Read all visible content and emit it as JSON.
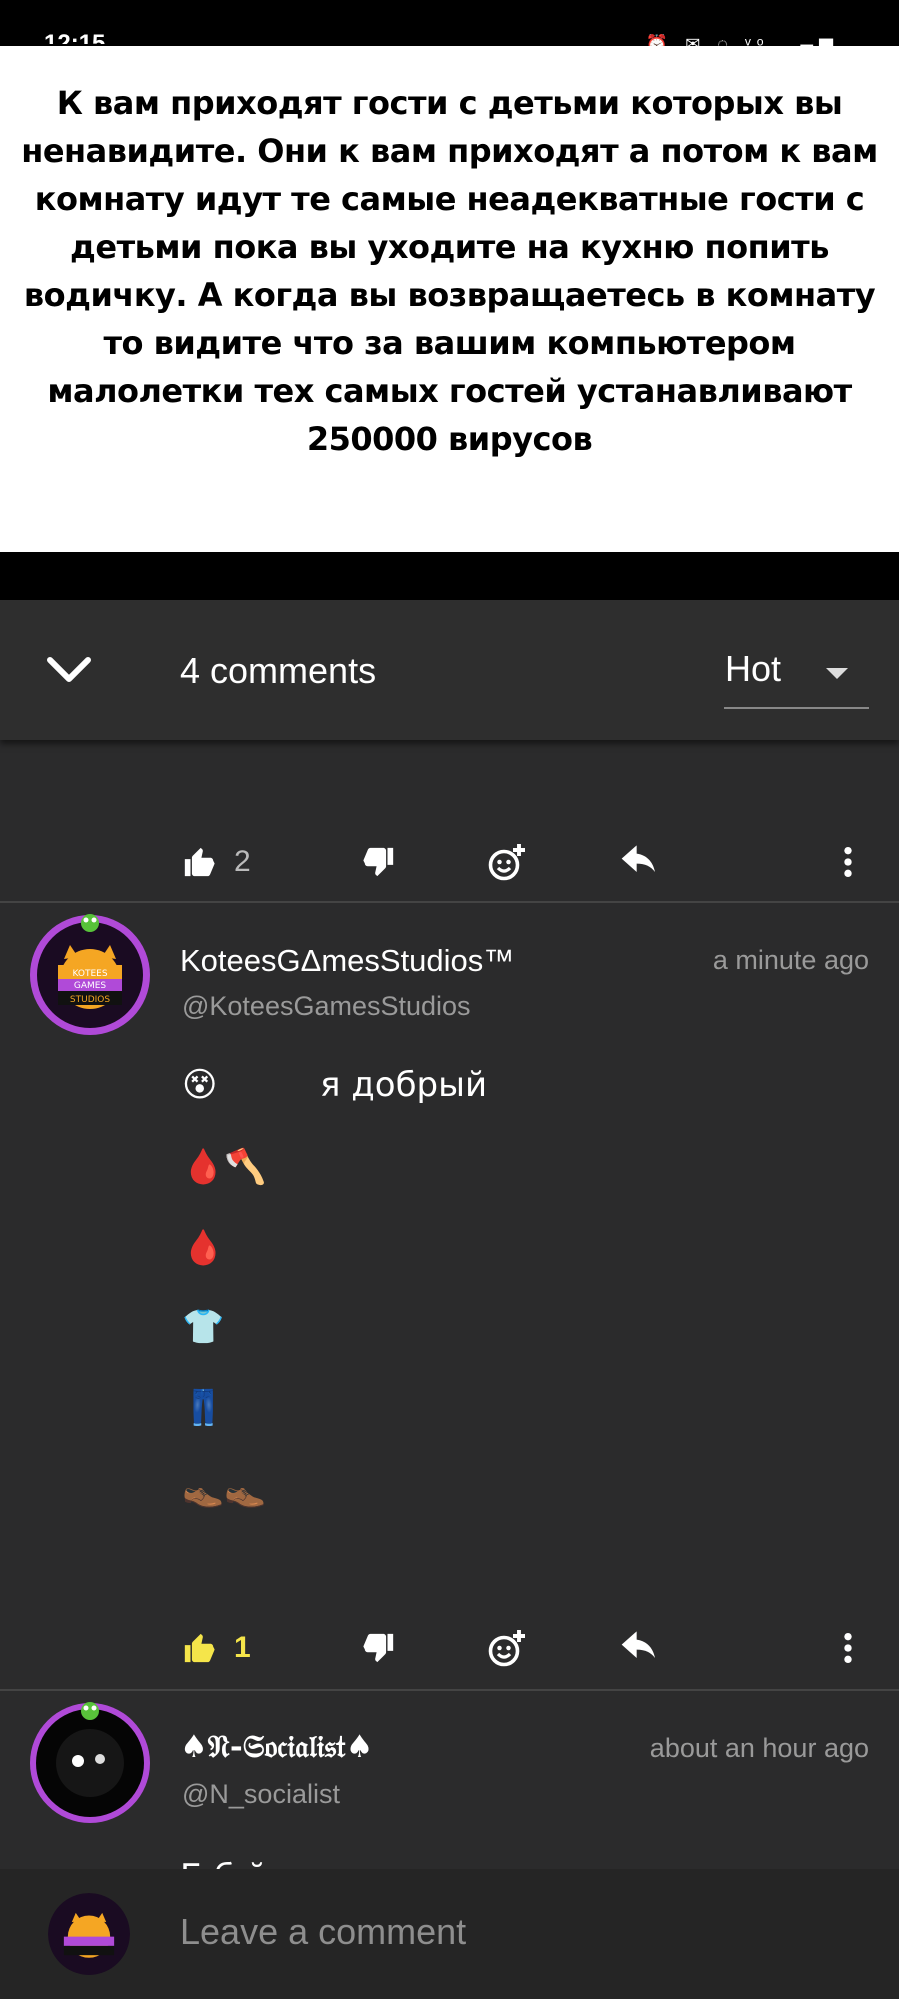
{
  "status_bar": {
    "time": "12:15",
    "icons": "⏰ ✉ ◌ ᵛᵒ ▂▄▆"
  },
  "meme": {
    "text": "К вам приходят гости с детьми которых вы ненавидите. Они к вам приходят а потом к вам комнату идут те самые неадекватные гости с детьми пока вы уходите на кухню попить водичку. А когда вы возвращаетесь в комнату то видите что за вашим компьютером малолетки тех самых гостей устанавливают 250000 вирусов"
  },
  "header": {
    "comment_count": "4 comments",
    "sort_label": "Hot"
  },
  "first_actions": {
    "like_count": "2"
  },
  "comments": [
    {
      "author": "KoteesGΔmesStudios™",
      "handle": "@KoteesGamesStudios",
      "time": "a minute ago",
      "line1_emoji": "😵",
      "line1_text": "я добрый",
      "emoji_lines": [
        "🩸🪓",
        "🩸",
        "👕",
        "👖",
        "👞👞"
      ],
      "like_count": "1",
      "avatar_text": [
        "KOTEES",
        "GAMES",
        "STUDIOS"
      ]
    },
    {
      "author": "♠𝔑-𝔖𝔬𝔠𝔦𝔞𝔩𝔦𝔰𝔱♠",
      "handle": "@N_socialist",
      "time": "about an hour ago",
      "partial_text": "Б  б  й"
    }
  ],
  "composer": {
    "placeholder": "Leave a comment"
  },
  "colors": {
    "like_active": "#f5e54a",
    "background": "#2b2b2c",
    "header": "#2e2e2e",
    "avatar_purple": "#b04ad8"
  }
}
